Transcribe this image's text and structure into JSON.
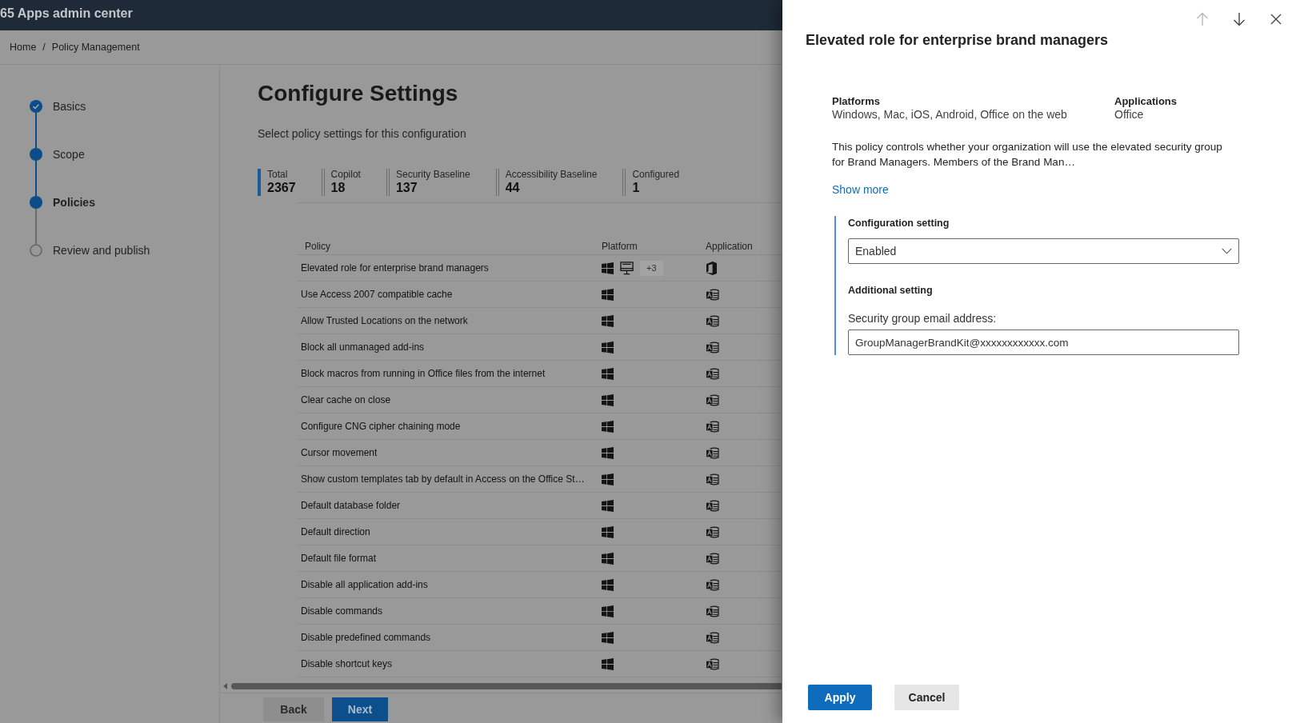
{
  "header": {
    "title": "65 Apps admin center"
  },
  "breadcrumb": {
    "items": [
      "Home",
      "Policy Management"
    ],
    "separator": "/"
  },
  "steps": [
    {
      "label": "Basics",
      "kind": "completed",
      "selected": false
    },
    {
      "label": "Scope",
      "kind": "visited",
      "selected": false
    },
    {
      "label": "Policies",
      "kind": "visited",
      "selected": true
    },
    {
      "label": "Review and publish",
      "kind": "upcoming",
      "selected": false
    }
  ],
  "main": {
    "title": "Configure Settings",
    "subtitle": "Select policy settings for this configuration",
    "stats": [
      {
        "label": "Total",
        "value": "2367",
        "selected": true
      },
      {
        "label": "Copilot",
        "value": "18",
        "selected": false
      },
      {
        "label": "Security Baseline",
        "value": "137",
        "selected": false
      },
      {
        "label": "Accessibility Baseline",
        "value": "44",
        "selected": false
      },
      {
        "label": "Configured",
        "value": "1",
        "selected": false
      }
    ]
  },
  "table": {
    "columns": [
      "Policy",
      "Platform",
      "Application"
    ],
    "rows": [
      {
        "policy": "Elevated role for enterprise brand managers",
        "platforms": [
          {
            "kind": "windows"
          },
          {
            "kind": "desktop"
          }
        ],
        "more_platforms": "+3",
        "application": {
          "kind": "office"
        }
      },
      {
        "policy": "Use Access 2007 compatible cache",
        "platforms": [
          {
            "kind": "windows"
          }
        ],
        "application": {
          "kind": "access"
        }
      },
      {
        "policy": "Allow Trusted Locations on the network",
        "platforms": [
          {
            "kind": "windows"
          }
        ],
        "application": {
          "kind": "access"
        }
      },
      {
        "policy": "Block all unmanaged add-ins",
        "platforms": [
          {
            "kind": "windows"
          }
        ],
        "application": {
          "kind": "access"
        }
      },
      {
        "policy": "Block macros from running in Office files from the internet",
        "platforms": [
          {
            "kind": "windows"
          }
        ],
        "application": {
          "kind": "access"
        }
      },
      {
        "policy": "Clear cache on close",
        "platforms": [
          {
            "kind": "windows"
          }
        ],
        "application": {
          "kind": "access"
        }
      },
      {
        "policy": "Configure CNG cipher chaining mode",
        "platforms": [
          {
            "kind": "windows"
          }
        ],
        "application": {
          "kind": "access"
        }
      },
      {
        "policy": "Cursor movement",
        "platforms": [
          {
            "kind": "windows"
          }
        ],
        "application": {
          "kind": "access"
        }
      },
      {
        "policy": "Show custom templates tab by default in Access on the Office St…",
        "platforms": [
          {
            "kind": "windows"
          }
        ],
        "application": {
          "kind": "access"
        }
      },
      {
        "policy": "Default database folder",
        "platforms": [
          {
            "kind": "windows"
          }
        ],
        "application": {
          "kind": "access"
        }
      },
      {
        "policy": "Default direction",
        "platforms": [
          {
            "kind": "windows"
          }
        ],
        "application": {
          "kind": "access"
        }
      },
      {
        "policy": "Default file format",
        "platforms": [
          {
            "kind": "windows"
          }
        ],
        "application": {
          "kind": "access"
        }
      },
      {
        "policy": "Disable all application add-ins",
        "platforms": [
          {
            "kind": "windows"
          }
        ],
        "application": {
          "kind": "access"
        }
      },
      {
        "policy": "Disable commands",
        "platforms": [
          {
            "kind": "windows"
          }
        ],
        "application": {
          "kind": "access"
        }
      },
      {
        "policy": "Disable predefined commands",
        "platforms": [
          {
            "kind": "windows"
          }
        ],
        "application": {
          "kind": "access"
        }
      },
      {
        "policy": "Disable shortcut keys",
        "platforms": [
          {
            "kind": "windows"
          }
        ],
        "application": {
          "kind": "access"
        }
      }
    ]
  },
  "footer": {
    "buttons": [
      {
        "label": "Back",
        "kind": "secondary"
      },
      {
        "label": "Next",
        "kind": "primary"
      }
    ]
  },
  "panel": {
    "nav": [
      {
        "kind": "up",
        "disabled": true
      },
      {
        "kind": "down",
        "disabled": false
      },
      {
        "kind": "close",
        "disabled": false
      }
    ],
    "title": "Elevated role for enterprise brand managers",
    "details": [
      {
        "label": "Platforms",
        "value": "Windows, Mac, iOS, Android, Office on the web"
      },
      {
        "label": "Applications",
        "value": "Office"
      }
    ],
    "description": "This policy controls whether your organization will use the elevated security group for Brand Managers. Members of the Brand Man…",
    "show_more": "Show more",
    "configuration": {
      "label": "Configuration setting",
      "value": "Enabled"
    },
    "additional": {
      "heading": "Additional setting",
      "field_label": "Security group email address:",
      "value": "GroupManagerBrandKit@xxxxxxxxxxxx.com"
    },
    "actions": [
      {
        "label": "Apply",
        "kind": "primary"
      },
      {
        "label": "Cancel",
        "kind": "secondary"
      }
    ]
  }
}
